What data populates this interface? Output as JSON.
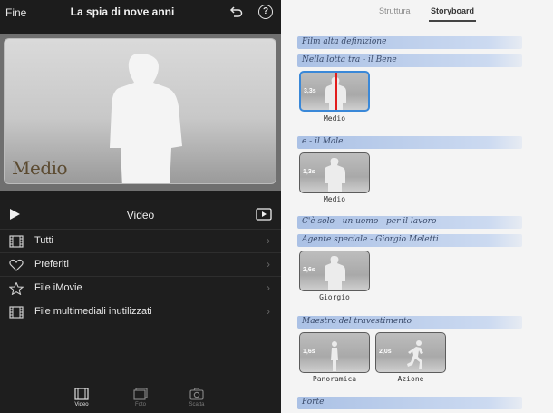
{
  "header": {
    "done_label": "Fine",
    "project_title": "La spia di nove anni",
    "help_label": "?"
  },
  "viewer": {
    "overlay_title": "Medio"
  },
  "browser": {
    "title": "Video",
    "items": [
      {
        "label": "Tutti",
        "icon": "film-strip-icon"
      },
      {
        "label": "Preferiti",
        "icon": "heart-icon"
      },
      {
        "label": "File iMovie",
        "icon": "star-icon"
      },
      {
        "label": "File multimediali inutilizzati",
        "icon": "film-strip-icon"
      }
    ]
  },
  "tabbar": {
    "tabs": [
      {
        "label": "Video",
        "icon": "film-icon",
        "active": true
      },
      {
        "label": "Foto",
        "icon": "photo-icon",
        "active": false
      },
      {
        "label": "Scatta",
        "icon": "camera-icon",
        "active": false
      }
    ]
  },
  "storyboard": {
    "tabs": [
      {
        "label": "Struttura",
        "active": false
      },
      {
        "label": "Storyboard",
        "active": true
      }
    ],
    "titles": [
      "Film alta definizione",
      "Nella lotta tra - il Bene",
      "e - il Male",
      "C'è solo - un uomo - per il lavoro",
      "Agente speciale - Giorgio Meletti",
      "Maestro del travestimento",
      "Forte"
    ],
    "clips": [
      {
        "duration": "3,3s",
        "name": "Medio"
      },
      {
        "duration": "1,3s",
        "name": "Medio"
      },
      {
        "duration": "2,6s",
        "name": "Giorgio"
      },
      {
        "duration": "1,6s",
        "name": "Panoramica"
      },
      {
        "duration": "2,0s",
        "name": "Azione"
      }
    ]
  },
  "colors": {
    "accent": "#3a88d8",
    "playhead": "#e21c1c",
    "title_strip": "#92b0e0"
  }
}
